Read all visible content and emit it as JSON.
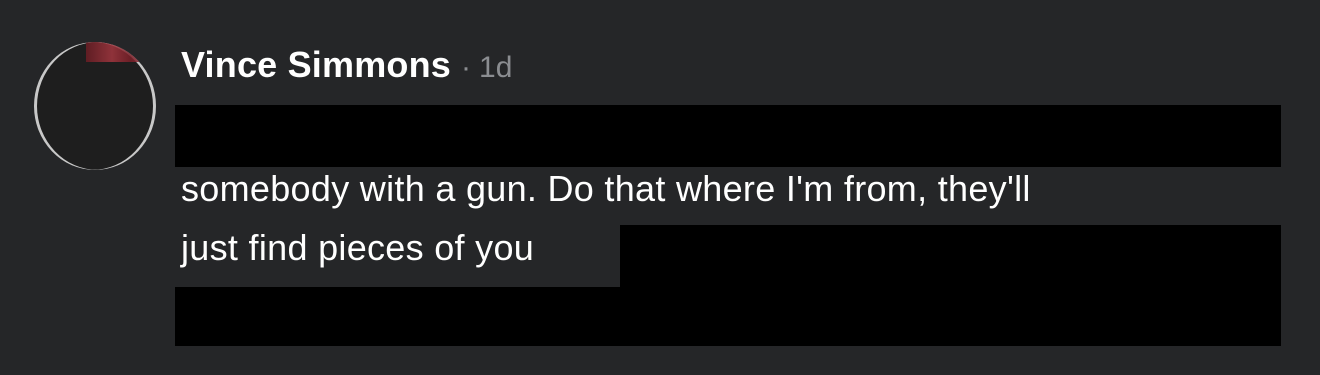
{
  "comment": {
    "author": "Vince Simmons",
    "separator": "·",
    "timestamp": "1d",
    "text_lines": [
      "somebody with a gun. Do that where I'm from, they'll",
      "just find pieces of you"
    ],
    "avatar_icon": "profile-avatar"
  },
  "colors": {
    "background": "#252628",
    "text": "#ffffff",
    "meta": "#8b8d91",
    "redaction": "#000000"
  }
}
